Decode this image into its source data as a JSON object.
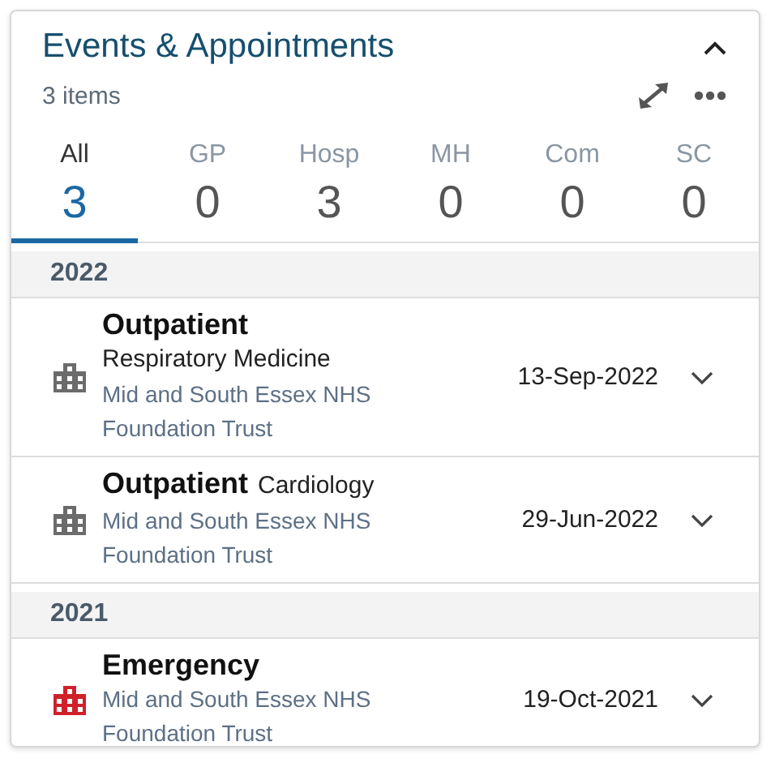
{
  "title": "Events & Appointments",
  "count": "3 items",
  "tabs": [
    {
      "label": "All",
      "count": "3",
      "selected": true
    },
    {
      "label": "GP",
      "count": "0",
      "selected": false
    },
    {
      "label": "Hosp",
      "count": "3",
      "selected": false
    },
    {
      "label": "MH",
      "count": "0",
      "selected": false
    },
    {
      "label": "Com",
      "count": "0",
      "selected": false
    },
    {
      "label": "SC",
      "count": "0",
      "selected": false
    }
  ],
  "groups": [
    {
      "year": "2022",
      "events": [
        {
          "type": "Outpatient",
          "specialty": "Respiratory Medicine",
          "organisation": "Mid and South Essex NHS Foundation Trust",
          "date": "13-Sep-2022",
          "color": "#6b6b6b"
        },
        {
          "type": "Outpatient",
          "specialty": "Cardiology",
          "organisation": "Mid and South Essex NHS Foundation Trust",
          "date": "29-Jun-2022",
          "color": "#6b6b6b"
        }
      ]
    },
    {
      "year": "2021",
      "events": [
        {
          "type": "Emergency",
          "organisation": "Mid and South Essex NHS Foundation Trust",
          "date": "19-Oct-2021",
          "color": "#d0202a"
        }
      ]
    }
  ]
}
